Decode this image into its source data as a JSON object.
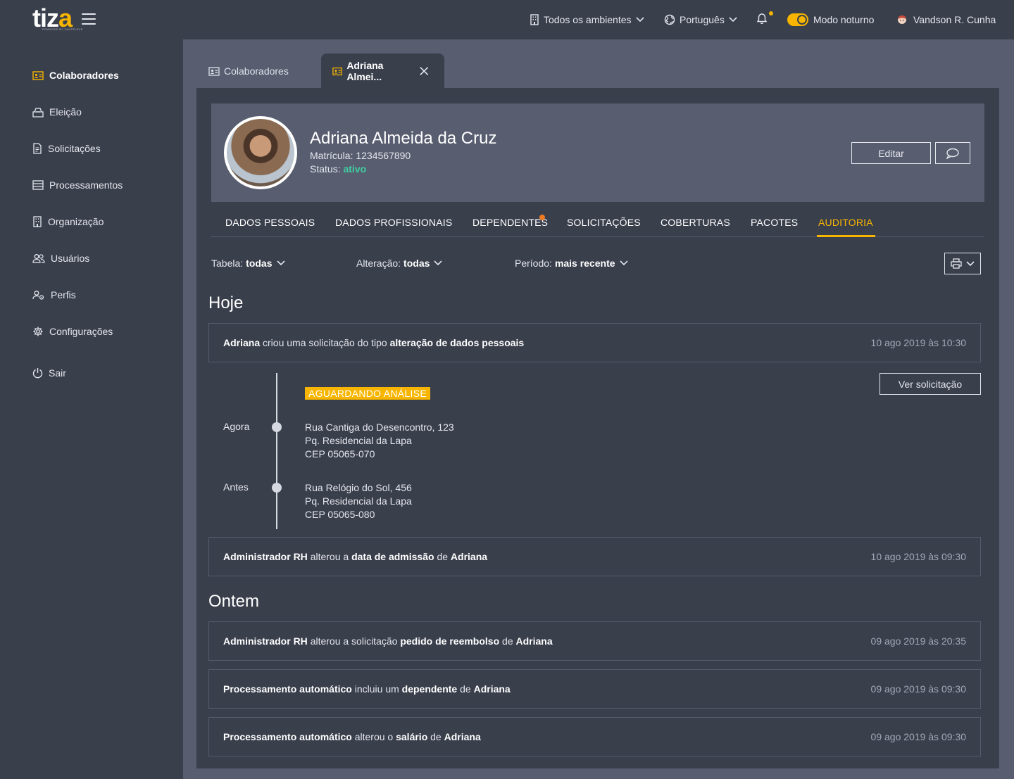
{
  "topbar": {
    "logo": "tiz",
    "logo_accent": "a",
    "logo_sub": "POWERED BY SANTÉLEVE",
    "environments": "Todos os ambientes",
    "language": "Português",
    "night_mode": "Modo noturno",
    "user": "Vandson R. Cunha"
  },
  "sidebar": {
    "items": [
      {
        "label": "Colaboradores",
        "icon": "id-card-icon",
        "active": true
      },
      {
        "label": "Eleição",
        "icon": "ballot-box-icon"
      },
      {
        "label": "Solicitações",
        "icon": "document-icon"
      },
      {
        "label": "Processamentos",
        "icon": "list-icon"
      },
      {
        "label": "Organização",
        "icon": "building-icon"
      },
      {
        "label": "Usuários",
        "icon": "users-icon"
      },
      {
        "label": "Perfis",
        "icon": "profile-settings-icon"
      },
      {
        "label": "Configurações",
        "icon": "gear-icon"
      },
      {
        "label": "Sair",
        "icon": "power-icon"
      }
    ]
  },
  "tabs": [
    {
      "label": "Colaboradores"
    },
    {
      "label": "Adriana Almei..."
    }
  ],
  "profile": {
    "name": "Adriana Almeida da Cruz",
    "matricula_label": "Matrícula:",
    "matricula": "1234567890",
    "status_label": "Status:",
    "status": "ativo",
    "edit_label": "Editar"
  },
  "section_tabs": [
    "DADOS PESSOAIS",
    "DADOS PROFISSIONAIS",
    "DEPENDENTES",
    "SOLICITAÇÕES",
    "COBERTURAS",
    "PACOTES",
    "AUDITORIA"
  ],
  "filters": {
    "table_label": "Tabela:",
    "table_value": "todas",
    "change_label": "Alteração:",
    "change_value": "todas",
    "period_label": "Período:",
    "period_value": "mais recente"
  },
  "audit": {
    "today_title": "Hoje",
    "yesterday_title": "Ontem",
    "entry1": {
      "actor": "Adriana",
      "text": "criou uma solicitação do tipo",
      "object": "alteração de dados pessoais",
      "date": "10 ago 2019 às 10:30"
    },
    "detail": {
      "badge": "AGUARDANDO ANÁLISE",
      "view_button": "Ver solicitação",
      "now_label": "Agora",
      "now_lines": [
        "Rua Cantiga do Desencontro, 123",
        "Pq. Residencial da Lapa",
        "CEP 05065-070"
      ],
      "before_label": "Antes",
      "before_lines": [
        "Rua Relógio do Sol, 456",
        "Pq. Residencial da Lapa",
        "CEP 05065-080"
      ]
    },
    "entry2": {
      "actor": "Administrador RH",
      "text": "alterou a",
      "object": "data de admissão",
      "mid": "de",
      "target": "Adriana",
      "date": "10 ago 2019 às 09:30"
    },
    "entry3": {
      "actor": "Administrador RH",
      "text": "alterou a solicitação",
      "object": "pedido de reembolso",
      "mid": "de",
      "target": "Adriana",
      "date": "09 ago 2019 às 20:35"
    },
    "entry4": {
      "actor": "Processamento automático",
      "text": "incluiu um",
      "object": "dependente",
      "mid": "de",
      "target": "Adriana",
      "date": "09 ago 2019 às 09:30"
    },
    "entry5": {
      "actor": "Processamento automático",
      "text": "alterou o",
      "object": "salário",
      "mid": "de",
      "target": "Adriana",
      "date": "09 ago 2019 às 09:30"
    }
  },
  "colors": {
    "accent": "#f7b500",
    "active_status": "#3fd0a0",
    "notification": "#f07a22"
  }
}
